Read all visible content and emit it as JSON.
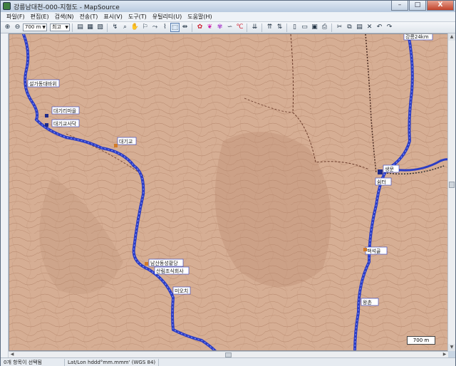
{
  "window": {
    "title": "강릉남대천-000-지형도 - MapSource",
    "minimize": "–",
    "maximize": "□",
    "close": "X"
  },
  "menu": [
    {
      "label": "파일(F)"
    },
    {
      "label": "편집(E)"
    },
    {
      "label": "검색(N)"
    },
    {
      "label": "전송(T)"
    },
    {
      "label": "표시(V)"
    },
    {
      "label": "도구(T)"
    },
    {
      "label": "유틸리티(U)"
    },
    {
      "label": "도움말(H)"
    }
  ],
  "toolbar": {
    "zoom_value": "700 m",
    "detail_value": "최고"
  },
  "map": {
    "labels": [
      {
        "text": "설가동대바위"
      },
      {
        "text": "대기리마을"
      },
      {
        "text": "대기교사닥"
      },
      {
        "text": "대기교"
      },
      {
        "text": "남산동성황당"
      },
      {
        "text": "산림조식회사"
      },
      {
        "text": "미오치"
      },
      {
        "text": "생문"
      },
      {
        "text": "쉼터"
      },
      {
        "text": "백석골"
      },
      {
        "text": "왕촌"
      },
      {
        "text": "강릉24km"
      }
    ],
    "scale": "700 m"
  },
  "status": {
    "selection": "0개 항목이 선택됨",
    "coords": "Lat/Lon hddd°mm.mmm' (WGS 84)"
  },
  "colors": {
    "track": "#2b3cc4",
    "terrain": "#d9b39c",
    "contour": "#9b6a4e"
  }
}
